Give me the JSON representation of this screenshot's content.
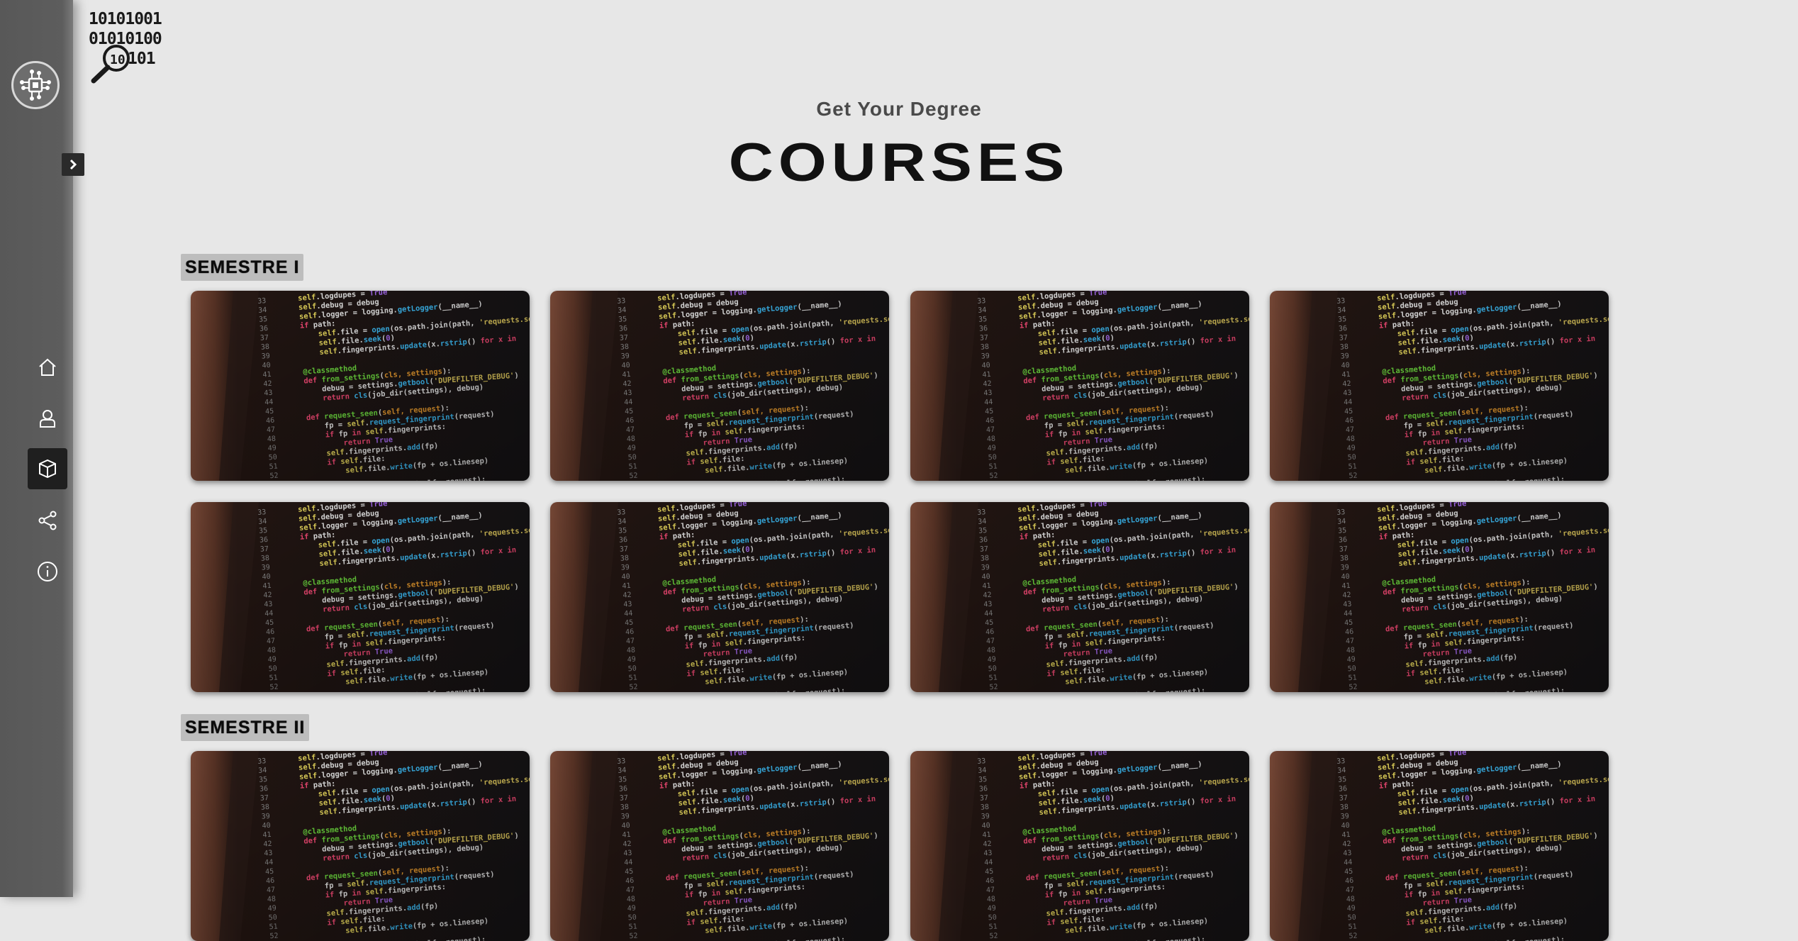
{
  "brand": {
    "bits": "10101001\n01010100\n    101",
    "logo_icon": "binary-magnifier-logo"
  },
  "header": {
    "subtitle": "Get Your Degree",
    "title": "COURSES"
  },
  "sidebar": {
    "logo_icon": "circuit-chip-icon",
    "expand_icon": "chevron-right-icon",
    "items": [
      {
        "icon": "home-icon",
        "active": false
      },
      {
        "icon": "user-icon",
        "active": false
      },
      {
        "icon": "box-icon",
        "active": true
      },
      {
        "icon": "share-icon",
        "active": false
      },
      {
        "icon": "info-icon",
        "active": false
      }
    ]
  },
  "semesters": [
    {
      "label": "SEMESTRE I",
      "course_count": 8
    },
    {
      "label": "SEMESTRE II",
      "course_count": 4
    }
  ],
  "colors": {
    "background": "#e7e7e7",
    "sidebar": "#5d5d5d",
    "active_nav": "#1f1f1f",
    "semester_badge": "#bdbdbd"
  }
}
